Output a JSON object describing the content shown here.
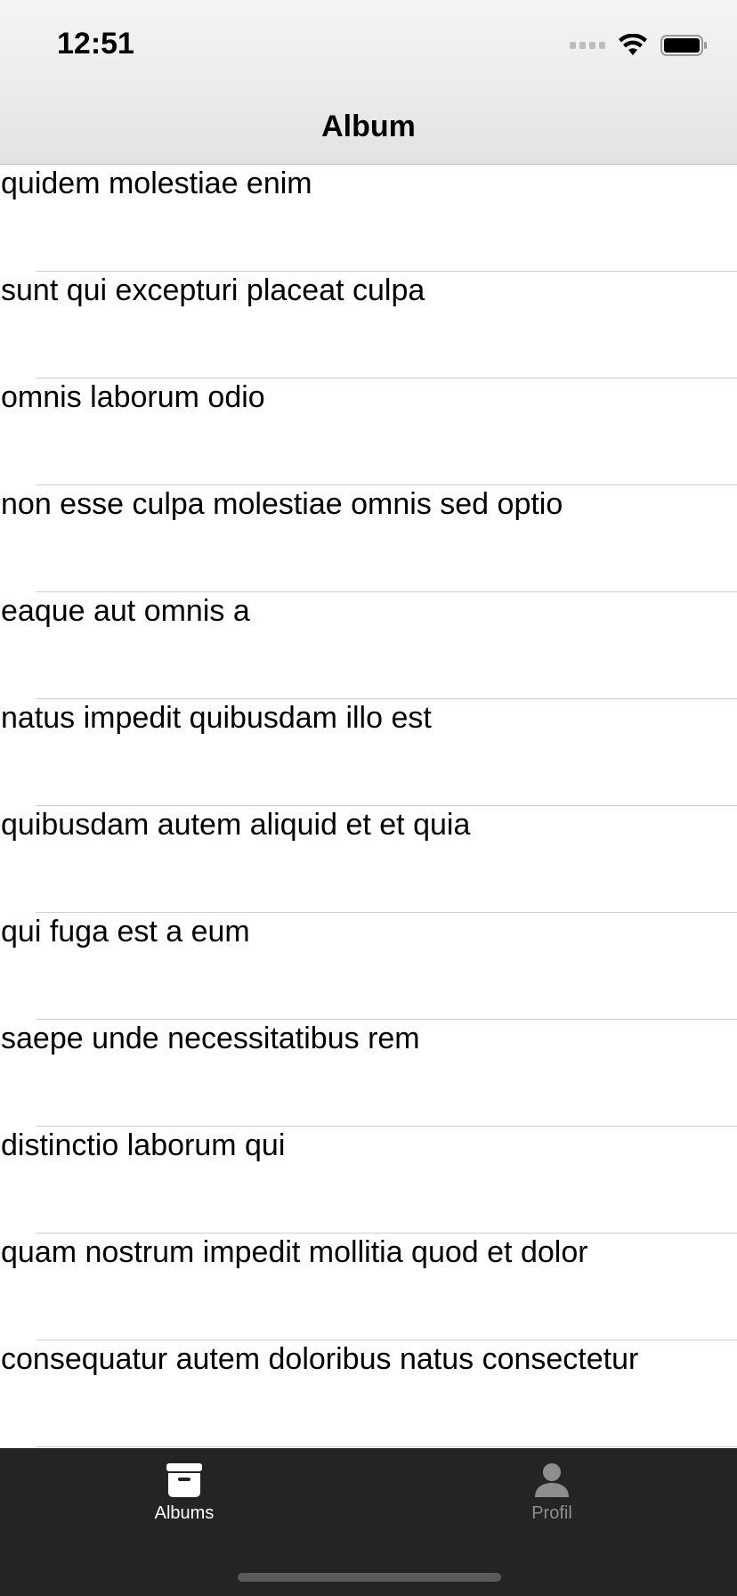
{
  "status_bar": {
    "time": "12:51"
  },
  "nav": {
    "title": "Album"
  },
  "albums": [
    "quidem molestiae enim",
    "sunt qui excepturi placeat culpa",
    "omnis laborum odio",
    "non esse culpa molestiae omnis sed optio",
    "eaque aut omnis a",
    "natus impedit quibusdam illo est",
    "quibusdam autem aliquid et et quia",
    "qui fuga est a eum",
    "saepe unde necessitatibus rem",
    "distinctio laborum qui",
    "quam nostrum impedit mollitia quod et dolor",
    "consequatur autem doloribus natus consectetur"
  ],
  "tab_bar": {
    "albums_label": "Albums",
    "albums_icon": "archive-box-icon",
    "profil_label": "Profil",
    "profil_icon": "person-icon",
    "active_tab": "Albums"
  }
}
